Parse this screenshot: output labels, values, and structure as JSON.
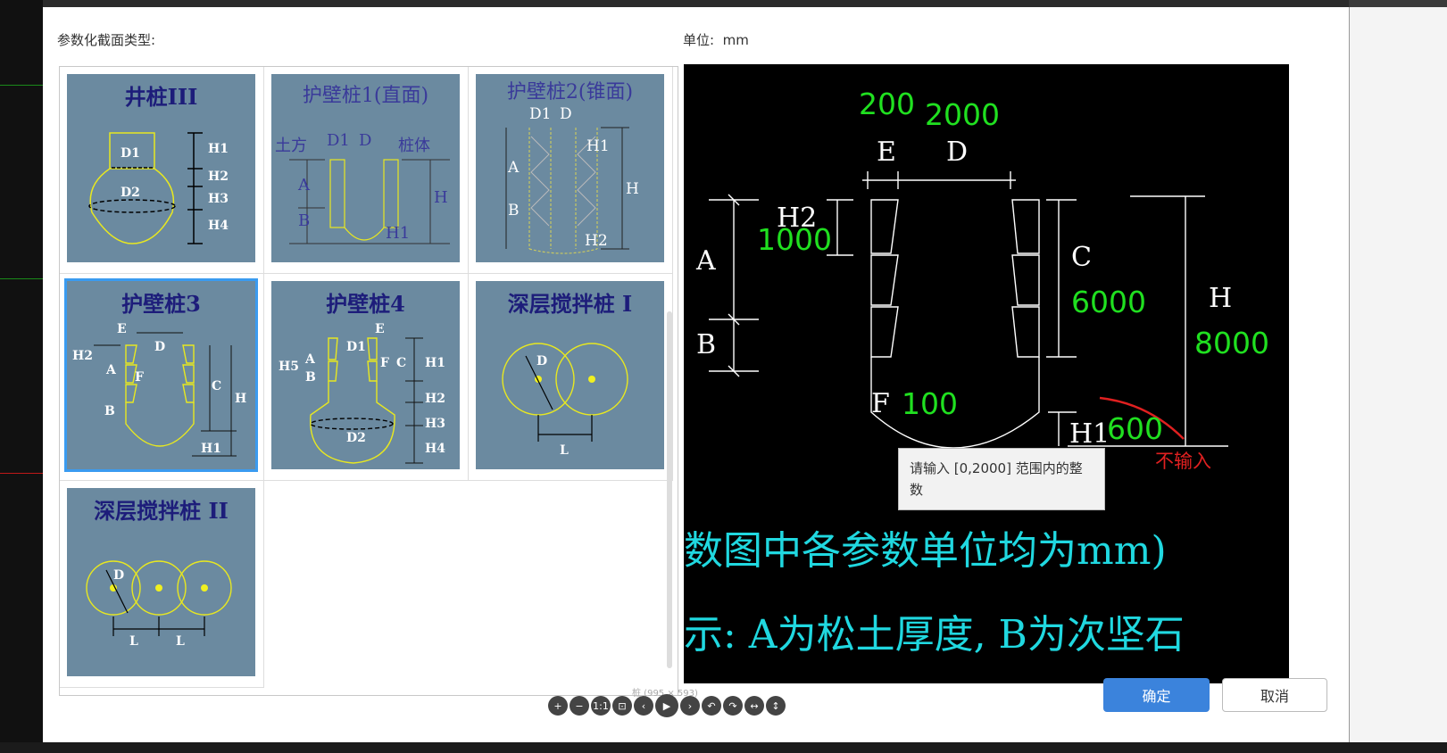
{
  "header": {
    "section_type_label": "参数化截面类型:",
    "unit_label": "单位:",
    "unit_value": "mm"
  },
  "thumbnails": [
    {
      "title": "井桩III",
      "labels": [
        "D1",
        "D2",
        "H1",
        "H2",
        "H3",
        "H4"
      ]
    },
    {
      "title": "护壁桩1(直面)",
      "labels": [
        "土方",
        "D1",
        "D",
        "桩体",
        "A",
        "B",
        "H",
        "H1"
      ]
    },
    {
      "title": "护壁桩2(锥面)",
      "labels": [
        "D1",
        "D",
        "A",
        "B",
        "H1",
        "H",
        "H2"
      ]
    },
    {
      "title": "护壁桩3",
      "labels": [
        "E",
        "D",
        "H2",
        "A",
        "F",
        "B",
        "C",
        "H",
        "H1"
      ]
    },
    {
      "title": "护壁桩4",
      "labels": [
        "E",
        "D1",
        "H5",
        "A",
        "B",
        "F",
        "C",
        "H1",
        "H2",
        "H3",
        "H4",
        "D2"
      ]
    },
    {
      "title": "深层搅拌桩 I",
      "labels": [
        "D",
        "L"
      ]
    },
    {
      "title": "深层搅拌桩 II",
      "labels": [
        "D",
        "L",
        "L"
      ]
    }
  ],
  "selected_index": 3,
  "preview": {
    "values": {
      "E": "200",
      "D": "2000",
      "H2": "1000",
      "C": "6000",
      "H": "8000",
      "F": "100",
      "H1": "600"
    },
    "labels": {
      "E": "E",
      "D": "D",
      "H2": "H2",
      "A": "A",
      "B": "B",
      "C": "C",
      "H": "H",
      "F": "F",
      "H1": "H1"
    },
    "annotation": "不输入",
    "note_line1": "数图中各参数单位均为mm)",
    "note_line2": "示: A为松土厚度, B为次坚石",
    "tooltip": "请输入 [0,2000] 范围内的整数"
  },
  "buttons": {
    "ok": "确定",
    "cancel": "取消"
  },
  "viewer": {
    "dimensions": "桩 (995 × 593)"
  }
}
